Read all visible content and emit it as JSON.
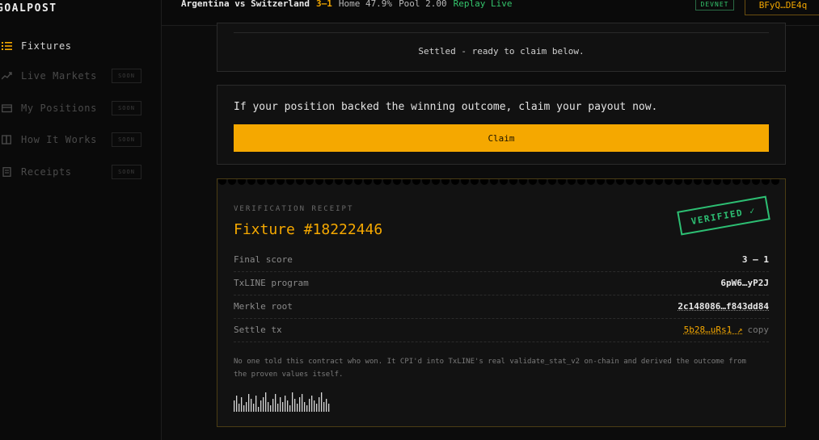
{
  "brand": "GOALPOST",
  "sidebar": {
    "items": [
      {
        "label": "Fixtures",
        "active": true,
        "badge": "",
        "icon": "list-icon"
      },
      {
        "label": "Live Markets",
        "active": false,
        "badge": "SOON",
        "icon": "trend-icon"
      },
      {
        "label": "My Positions",
        "active": false,
        "badge": "SOON",
        "icon": "wallet-icon"
      },
      {
        "label": "How It Works",
        "active": false,
        "badge": "SOON",
        "icon": "book-icon"
      },
      {
        "label": "Receipts",
        "active": false,
        "badge": "SOON",
        "icon": "receipt-icon"
      }
    ]
  },
  "topbar": {
    "teams": "Argentina vs Switzerland",
    "score": "3–1",
    "home": "Home 47.9%",
    "pool": "Pool 2.00",
    "replay": "Replay Live",
    "network": "DEVNET",
    "wallet": "BFyQ…DE4q"
  },
  "settled": {
    "message": "Settled - ready to claim below."
  },
  "claim": {
    "message": "If your position backed the winning outcome, claim your payout now.",
    "button": "Claim"
  },
  "receipt": {
    "kicker": "VERIFICATION RECEIPT",
    "title": "Fixture #18222446",
    "stamp": "VERIFIED ✓",
    "rows": [
      {
        "label": "Final score",
        "value": "3 – 1"
      },
      {
        "label": "TxLINE program",
        "value": "6pW6…yP2J"
      },
      {
        "label": "Merkle root",
        "value": "2c148086…f843dd84"
      },
      {
        "label": "Settle tx",
        "value": "5b28…uRs1 ↗",
        "action": "copy"
      }
    ],
    "note": "No one told this contract who won. It CPI'd into TxLINE's real validate_stat_v2 on-chain and derived the outcome from the proven values itself."
  },
  "colors": {
    "accent": "#f5a800",
    "success": "#2dbf73",
    "bg": "#0c0c0c",
    "panel": "#111111"
  }
}
